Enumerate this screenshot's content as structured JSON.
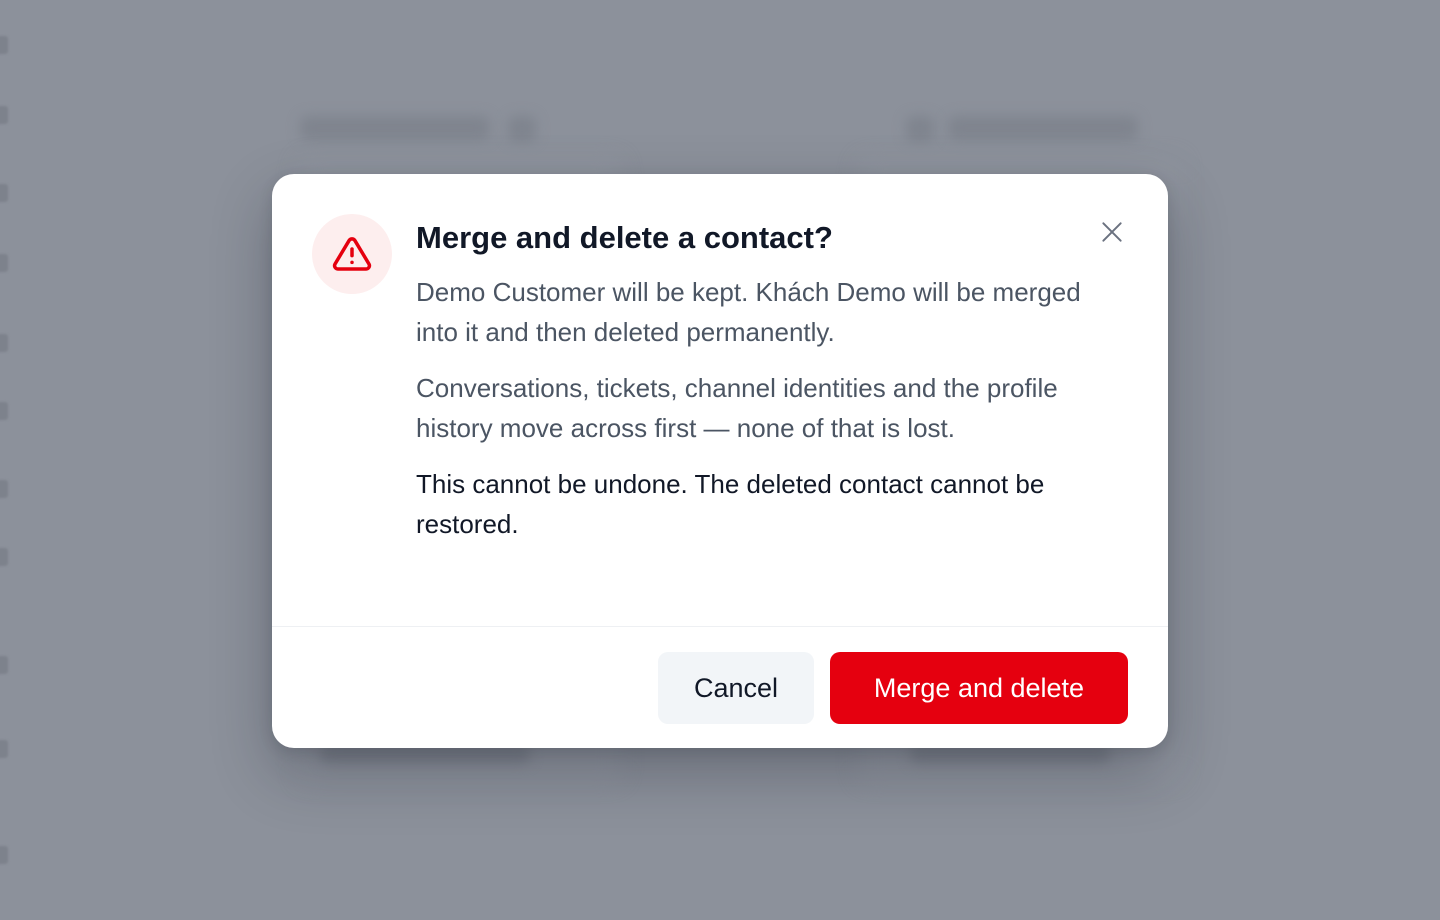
{
  "dialog": {
    "title": "Merge and delete a contact?",
    "paragraph_1": "Demo Customer will be kept. Khách Demo will be merged into it and then deleted permanently.",
    "paragraph_2": "Conversations, tickets, channel identities and the profile history move across first — none of that is lost.",
    "warning": "This cannot be undone. The deleted contact cannot be restored.",
    "icons": {
      "warning": "warning-triangle-icon",
      "close": "close-icon"
    }
  },
  "actions": {
    "cancel_label": "Cancel",
    "confirm_label": "Merge and delete"
  },
  "colors": {
    "danger": "#e5000f",
    "danger_soft": "#fdeeee",
    "overlay": "#8c919b"
  }
}
